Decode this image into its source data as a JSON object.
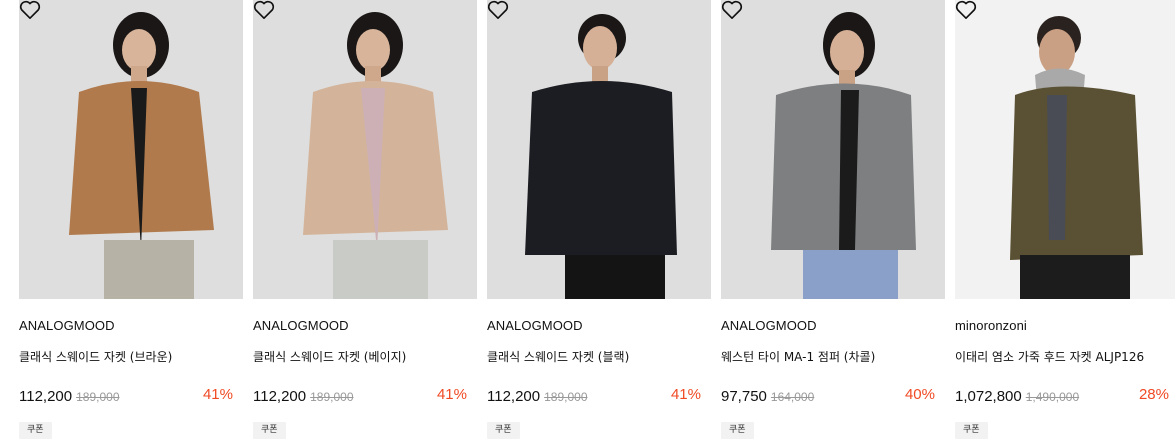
{
  "products": [
    {
      "brand": "ANALOGMOOD",
      "name": "클래식 스웨이드 자켓 (브라운)",
      "price": "112,200",
      "original_price": "189,000",
      "discount": "41%",
      "coupon": "쿠폰",
      "jacket_color": "#b07a4c",
      "icon": "heart-icon"
    },
    {
      "brand": "ANALOGMOOD",
      "name": "클래식 스웨이드 자켓 (베이지)",
      "price": "112,200",
      "original_price": "189,000",
      "discount": "41%",
      "coupon": "쿠폰",
      "jacket_color": "#d3b49a",
      "icon": "heart-icon"
    },
    {
      "brand": "ANALOGMOOD",
      "name": "클래식 스웨이드 자켓 (블랙)",
      "price": "112,200",
      "original_price": "189,000",
      "discount": "41%",
      "coupon": "쿠폰",
      "jacket_color": "#1c1d22",
      "icon": "heart-icon"
    },
    {
      "brand": "ANALOGMOOD",
      "name": "웨스턴 타이 MA-1 점퍼 (차콜)",
      "price": "97,750",
      "original_price": "164,000",
      "discount": "40%",
      "coupon": "쿠폰",
      "jacket_color": "#7d7f80",
      "icon": "heart-icon"
    },
    {
      "brand": "minoronzoni",
      "name": "이태리 염소 가죽 후드 자켓 ALJP126",
      "price": "1,072,800",
      "original_price": "1,490,000",
      "discount": "28%",
      "coupon": "쿠폰",
      "jacket_color": "#5a5033",
      "icon": "heart-icon"
    }
  ],
  "colors": {
    "discount": "#f04a24",
    "image_background": "#dcdcdc"
  }
}
